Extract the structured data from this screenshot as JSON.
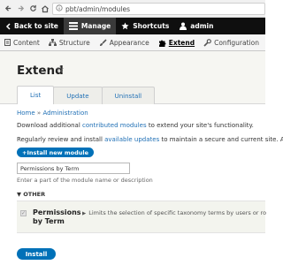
{
  "browser": {
    "url": "pbt/admin/modules"
  },
  "toolbar": {
    "back": "Back to site",
    "manage": "Manage",
    "shortcuts": "Shortcuts",
    "user": "admin"
  },
  "tray": {
    "items": [
      {
        "label": "Content"
      },
      {
        "label": "Structure"
      },
      {
        "label": "Appearance"
      },
      {
        "label": "Extend"
      },
      {
        "label": "Configuration"
      }
    ]
  },
  "page": {
    "title": "Extend",
    "tabs": [
      {
        "label": "List"
      },
      {
        "label": "Update"
      },
      {
        "label": "Uninstall"
      }
    ]
  },
  "breadcrumb": {
    "home": "Home",
    "sep": "»",
    "admin": "Administration"
  },
  "intro": {
    "p1_a": "Download additional ",
    "p1_link": "contributed modules",
    "p1_b": " to extend your site's functionality.",
    "p2_a": "Regularly review and install ",
    "p2_link": "available updates",
    "p2_b": " to maintain a secure and current site. Al"
  },
  "install_new": "+Install new module",
  "filter": {
    "value": "Permissions by Term",
    "description": "Enter a part of the module name or description"
  },
  "group": {
    "label": "▼ OTHER"
  },
  "module": {
    "name": "Permissions by Term",
    "description": "Limits the selection of specific taxonomy terms by users or ro"
  },
  "install_button": "Install"
}
